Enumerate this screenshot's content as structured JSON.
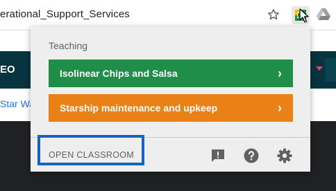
{
  "browser": {
    "url_text": "erational_Support_Services",
    "icons": [
      "star-icon",
      "extension-icon",
      "google-drive-icon",
      "mouse-cursor-icon"
    ]
  },
  "page": {
    "logo_text": "EO",
    "link_text": "Star Wa"
  },
  "popup": {
    "section_title": "Teaching",
    "classes": [
      {
        "name": "Isolinear Chips and Salsa",
        "color": "#1e8e48"
      },
      {
        "name": "Starship maintenance and upkeep",
        "color": "#ea8116"
      }
    ],
    "chevron": "›",
    "open_classroom_label": "OPEN CLASSROOM",
    "highlight_color": "#1565c0",
    "footer_icons": [
      "feedback-icon",
      "help-icon",
      "settings-icon"
    ]
  }
}
